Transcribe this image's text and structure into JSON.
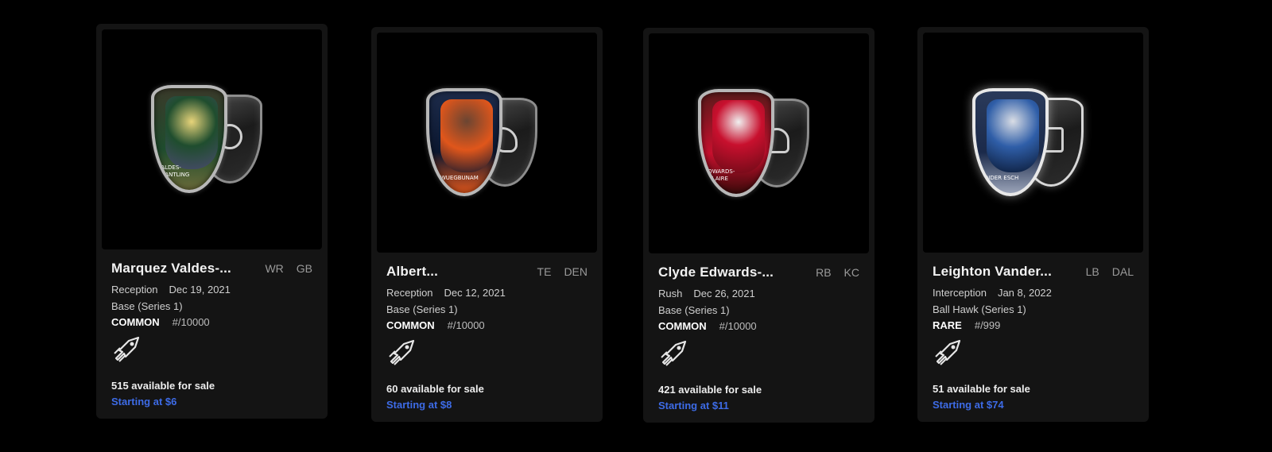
{
  "colors": {
    "background": "#000000",
    "card": "#141414",
    "price": "#3d6be6"
  },
  "cards": [
    {
      "name": "Marquez Valdes-...",
      "position": "WR",
      "team": "GB",
      "play_type": "Reception",
      "date": "Dec 19, 2021",
      "set": "Base (Series 1)",
      "rarity": "COMMON",
      "serial": "#/10000",
      "shield_name": "VALDES-\nSCANTLING",
      "available": "515 available for sale",
      "price": "Starting at $6",
      "jersey_color": "#1f4d2e",
      "logo_icon": "rocket-icon"
    },
    {
      "name": "Albert...",
      "position": "TE",
      "team": "DEN",
      "play_type": "Reception",
      "date": "Dec 12, 2021",
      "set": "Base (Series 1)",
      "rarity": "COMMON",
      "serial": "#/10000",
      "shield_name": "OKWUEGBUNAM",
      "available": "60 available for sale",
      "price": "Starting at $8",
      "jersey_color": "#e0561b",
      "logo_icon": "rocket-icon"
    },
    {
      "name": "Clyde Edwards-...",
      "position": "RB",
      "team": "KC",
      "play_type": "Rush",
      "date": "Dec 26, 2021",
      "set": "Base (Series 1)",
      "rarity": "COMMON",
      "serial": "#/10000",
      "shield_name": "EDWARDS-\nHELAIRE",
      "available": "421 available for sale",
      "price": "Starting at $11",
      "jersey_color": "#c8102e",
      "logo_icon": "rocket-icon"
    },
    {
      "name": "Leighton Vander...",
      "position": "LB",
      "team": "DAL",
      "play_type": "Interception",
      "date": "Jan 8, 2022",
      "set": "Ball Hawk (Series 1)",
      "rarity": "RARE",
      "serial": "#/999",
      "shield_name": "VANDER ESCH",
      "available": "51 available for sale",
      "price": "Starting at $74",
      "jersey_color": "#2f5ea8",
      "logo_icon": "rocket-icon"
    }
  ]
}
